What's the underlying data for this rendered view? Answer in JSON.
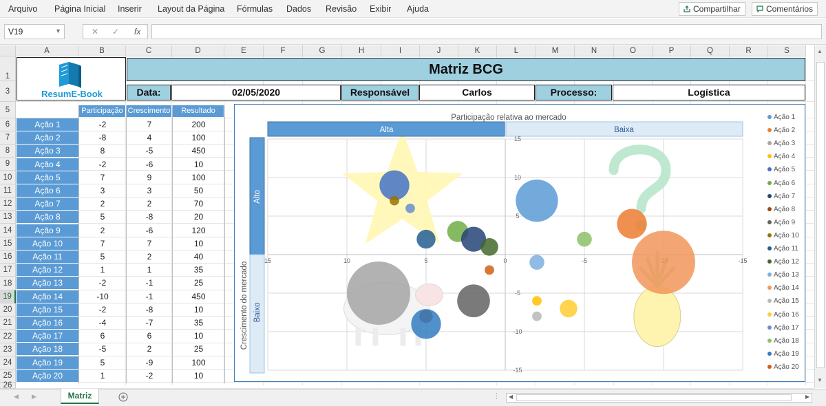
{
  "menu": [
    "Arquivo",
    "Página Inicial",
    "Inserir",
    "Layout da Página",
    "Fórmulas",
    "Dados",
    "Revisão",
    "Exibir",
    "Ajuda"
  ],
  "ribbon_buttons": {
    "share": "Compartilhar",
    "comments": "Comentários"
  },
  "formula_bar": {
    "name_box": "V19",
    "fx": "fx",
    "cancel": "✕",
    "confirm": "✓",
    "value": ""
  },
  "columns": [
    "A",
    "B",
    "C",
    "D",
    "E",
    "F",
    "G",
    "H",
    "I",
    "J",
    "K",
    "L",
    "M",
    "N",
    "O",
    "P",
    "Q",
    "R",
    "S"
  ],
  "rows": [
    "1",
    "3",
    "5",
    "6",
    "7",
    "8",
    "9",
    "10",
    "11",
    "12",
    "13",
    "14",
    "15",
    "16",
    "17",
    "18",
    "19",
    "20",
    "21",
    "22",
    "23",
    "24",
    "25",
    "26"
  ],
  "logo": {
    "text": "ResumE-Book"
  },
  "title": "Matriz BCG",
  "info": {
    "date_label": "Data:",
    "date_value": "02/05/2020",
    "resp_label": "Responsável",
    "resp_value": "Carlos",
    "proc_label": "Processo:",
    "proc_value": "Logística"
  },
  "table": {
    "headers": [
      "Participação",
      "Crescimento",
      "Resultado"
    ],
    "rows": [
      {
        "label": "Ação 1",
        "part": "-2",
        "cresc": "7",
        "res": "200"
      },
      {
        "label": "Ação 2",
        "part": "-8",
        "cresc": "4",
        "res": "100"
      },
      {
        "label": "Ação 3",
        "part": "8",
        "cresc": "-5",
        "res": "450"
      },
      {
        "label": "Ação 4",
        "part": "-2",
        "cresc": "-6",
        "res": "10"
      },
      {
        "label": "Ação 5",
        "part": "7",
        "cresc": "9",
        "res": "100"
      },
      {
        "label": "Ação 6",
        "part": "3",
        "cresc": "3",
        "res": "50"
      },
      {
        "label": "Ação 7",
        "part": "2",
        "cresc": "2",
        "res": "70"
      },
      {
        "label": "Ação 8",
        "part": "5",
        "cresc": "-8",
        "res": "20"
      },
      {
        "label": "Ação 9",
        "part": "2",
        "cresc": "-6",
        "res": "120"
      },
      {
        "label": "Ação 10",
        "part": "7",
        "cresc": "7",
        "res": "10"
      },
      {
        "label": "Ação 11",
        "part": "5",
        "cresc": "2",
        "res": "40"
      },
      {
        "label": "Ação 12",
        "part": "1",
        "cresc": "1",
        "res": "35"
      },
      {
        "label": "Ação 13",
        "part": "-2",
        "cresc": "-1",
        "res": "25"
      },
      {
        "label": "Ação 14",
        "part": "-10",
        "cresc": "-1",
        "res": "450"
      },
      {
        "label": "Ação 15",
        "part": "-2",
        "cresc": "-8",
        "res": "10"
      },
      {
        "label": "Ação 16",
        "part": "-4",
        "cresc": "-7",
        "res": "35"
      },
      {
        "label": "Ação 17",
        "part": "6",
        "cresc": "6",
        "res": "10"
      },
      {
        "label": "Ação 18",
        "part": "-5",
        "cresc": "2",
        "res": "25"
      },
      {
        "label": "Ação 19",
        "part": "5",
        "cresc": "-9",
        "res": "100"
      },
      {
        "label": "Ação 20",
        "part": "1",
        "cresc": "-2",
        "res": "10"
      }
    ]
  },
  "chart_data": {
    "type": "bubble",
    "title": "Participação relativa ao mercado",
    "ylabel": "Crescimento do mercado",
    "quadrant_labels": {
      "top_left": "Alta",
      "top_right": "Baixa",
      "left_top": "Alto",
      "left_bottom": "Baixo"
    },
    "xlim": [
      15,
      -15
    ],
    "ylim": [
      -15,
      15
    ],
    "xticks": [
      "15",
      "10",
      "5",
      "0",
      "-5",
      "-10",
      "-15"
    ],
    "yticks": [
      "15",
      "10",
      "5",
      "-5",
      "-10",
      "-15"
    ],
    "grid": true,
    "legend_position": "right",
    "series": [
      {
        "name": "Ação 1",
        "x": -2,
        "y": 7,
        "size": 200,
        "color": "#5b9bd5"
      },
      {
        "name": "Ação 2",
        "x": -8,
        "y": 4,
        "size": 100,
        "color": "#ed7d31"
      },
      {
        "name": "Ação 3",
        "x": 8,
        "y": -5,
        "size": 450,
        "color": "#a5a5a5"
      },
      {
        "name": "Ação 4",
        "x": -2,
        "y": -6,
        "size": 10,
        "color": "#ffc000"
      },
      {
        "name": "Ação 5",
        "x": 7,
        "y": 9,
        "size": 100,
        "color": "#4472c4"
      },
      {
        "name": "Ação 6",
        "x": 3,
        "y": 3,
        "size": 50,
        "color": "#70ad47"
      },
      {
        "name": "Ação 7",
        "x": 2,
        "y": 2,
        "size": 70,
        "color": "#264478"
      },
      {
        "name": "Ação 8",
        "x": 5,
        "y": -8,
        "size": 20,
        "color": "#9e480e"
      },
      {
        "name": "Ação 9",
        "x": 2,
        "y": -6,
        "size": 120,
        "color": "#636363"
      },
      {
        "name": "Ação 10",
        "x": 7,
        "y": 7,
        "size": 10,
        "color": "#997300"
      },
      {
        "name": "Ação 11",
        "x": 5,
        "y": 2,
        "size": 40,
        "color": "#255e91"
      },
      {
        "name": "Ação 12",
        "x": 1,
        "y": 1,
        "size": 35,
        "color": "#43682b"
      },
      {
        "name": "Ação 13",
        "x": -2,
        "y": -1,
        "size": 25,
        "color": "#7cafdd"
      },
      {
        "name": "Ação 14",
        "x": -10,
        "y": -1,
        "size": 450,
        "color": "#f1975a"
      },
      {
        "name": "Ação 15",
        "x": -2,
        "y": -8,
        "size": 10,
        "color": "#b7b7b7"
      },
      {
        "name": "Ação 16",
        "x": -4,
        "y": -7,
        "size": 35,
        "color": "#ffcd33"
      },
      {
        "name": "Ação 17",
        "x": 6,
        "y": 6,
        "size": 10,
        "color": "#698ed0"
      },
      {
        "name": "Ação 18",
        "x": -5,
        "y": 2,
        "size": 25,
        "color": "#8cc168"
      },
      {
        "name": "Ação 19",
        "x": 5,
        "y": -9,
        "size": 100,
        "color": "#327dc2"
      },
      {
        "name": "Ação 20",
        "x": 1,
        "y": -2,
        "size": 10,
        "color": "#d26012"
      }
    ]
  },
  "sheet_tab": "Matriz",
  "icons": [
    "share-icon",
    "comment-icon",
    "add-sheet-icon",
    "scroll-left-icon",
    "scroll-right-icon"
  ]
}
